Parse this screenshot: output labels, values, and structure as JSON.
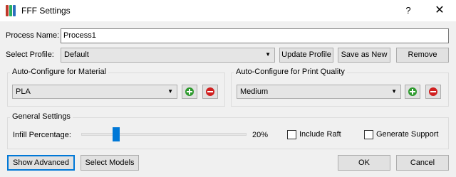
{
  "window": {
    "title": "FFF Settings",
    "help_glyph": "?",
    "close_glyph": "✕"
  },
  "process": {
    "label": "Process Name:",
    "value": "Process1"
  },
  "profile": {
    "label": "Select Profile:",
    "selected": "Default",
    "update_label": "Update Profile",
    "save_as_label": "Save as New",
    "remove_label": "Remove"
  },
  "material": {
    "title": "Auto-Configure for Material",
    "selected": "PLA"
  },
  "quality": {
    "title": "Auto-Configure for Print Quality",
    "selected": "Medium"
  },
  "general": {
    "title": "General Settings",
    "infill_label": "Infill Percentage:",
    "infill_percent": 20,
    "infill_text": "20%",
    "raft_label": "Include Raft",
    "raft_checked": false,
    "support_label": "Generate Support",
    "support_checked": false
  },
  "footer": {
    "show_advanced_label": "Show Advanced",
    "select_models_label": "Select Models",
    "ok_label": "OK",
    "cancel_label": "Cancel"
  },
  "colors": {
    "add": "#2e9a2e",
    "remove": "#d02020",
    "accent": "#0078d7"
  }
}
